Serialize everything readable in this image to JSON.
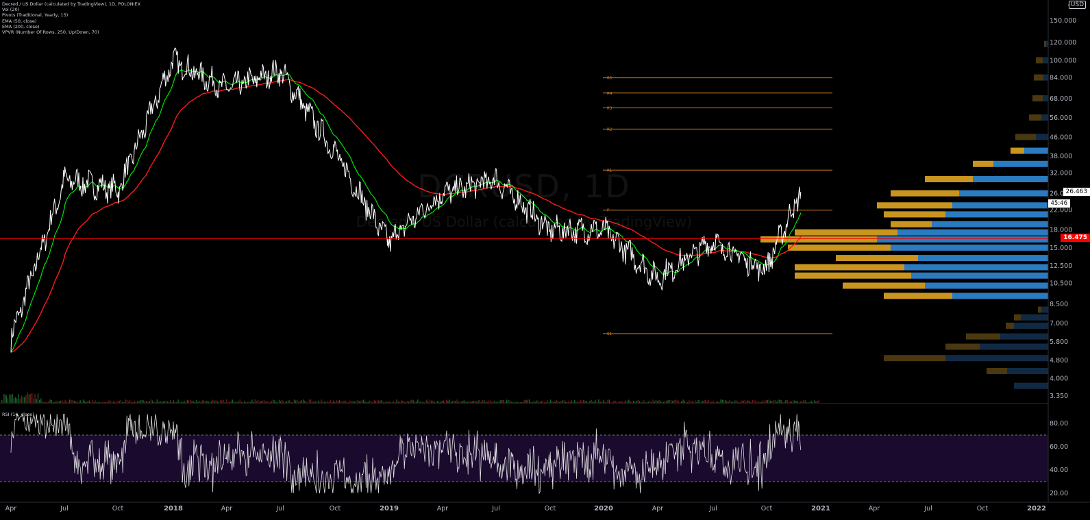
{
  "legend": {
    "symbol_line": "Decred / US Dollar (calculated by TradingView), 1D, POLONIEX",
    "indicators": [
      "Vol (20)",
      "Pivots (Traditional, Yearly, 15)",
      "EMA (50, close)",
      "EMA (200, close)",
      "VPVR (Number Of Rows, 250, Up/Down, 70)"
    ]
  },
  "watermark": {
    "symbol": "DCRUSD, 1D",
    "description": "Decred / US Dollar (calculated by TradingView)"
  },
  "currency": "USD",
  "rsi_label": "RSI (14, close)",
  "price_scale": {
    "ticks": [
      "150.000",
      "120.000",
      "100.000",
      "84.000",
      "68.000",
      "56.000",
      "46.000",
      "38.000",
      "32.000",
      "26.000",
      "22.000",
      "18.000",
      "15.000",
      "12.500",
      "10.500",
      "8.500",
      "7.000",
      "5.800",
      "4.800",
      "4.000",
      "3.350"
    ],
    "last_price": "26.463",
    "countdown": "45:46",
    "line_price": "16.475"
  },
  "rsi_scale": {
    "ticks": [
      "80.00",
      "60.00",
      "40.00",
      "20.00"
    ]
  },
  "time_axis": [
    "Apr",
    "Jul",
    "Oct",
    "2018",
    "Apr",
    "Jul",
    "Oct",
    "2019",
    "Apr",
    "Jul",
    "Oct",
    "2020",
    "Apr",
    "Jul",
    "Oct",
    "2021",
    "Apr",
    "Jul",
    "Oct",
    "2022"
  ],
  "pivot_labels": [
    "R5",
    "R4",
    "R3",
    "R2",
    "R1",
    "P",
    "S1"
  ],
  "colors": {
    "background": "#000000",
    "price": "#ffffff",
    "ema50": "#00e600",
    "ema200": "#ff1a1a",
    "horizontal_line": "#ff0000",
    "pivot": "#d4822a",
    "vpvr_up": "#2b7bc0",
    "vpvr_down": "#c9951f",
    "rsi_band": "#1a0a2e",
    "rsi_line": "#e0e0e0"
  },
  "chart_data": {
    "type": "line",
    "title": "Decred / US Dollar (calculated by TradingView), 1D, POLONIEX",
    "x": [
      "2017-04",
      "2017-07",
      "2017-10",
      "2018-01",
      "2018-04",
      "2018-07",
      "2018-10",
      "2019-01",
      "2019-04",
      "2019-07",
      "2019-10",
      "2020-01",
      "2020-04",
      "2020-07",
      "2020-10",
      "2020-12"
    ],
    "series": [
      {
        "values": [
          6,
          30,
          27,
          100,
          75,
          90,
          40,
          16,
          26,
          30,
          18,
          18,
          11,
          16,
          12,
          26.5
        ]
      }
    ],
    "y_scale": "log",
    "ylim": [
      3.35,
      150
    ],
    "pivots": {
      "R5": 84,
      "R4": 72,
      "R3": 62,
      "R2": 50,
      "R1": 33,
      "P": 22,
      "S1": 6.3
    },
    "horizontal_line": 16.475,
    "rsi": {
      "ylim": [
        20,
        90
      ],
      "overbought": 70,
      "oversold": 30
    }
  }
}
